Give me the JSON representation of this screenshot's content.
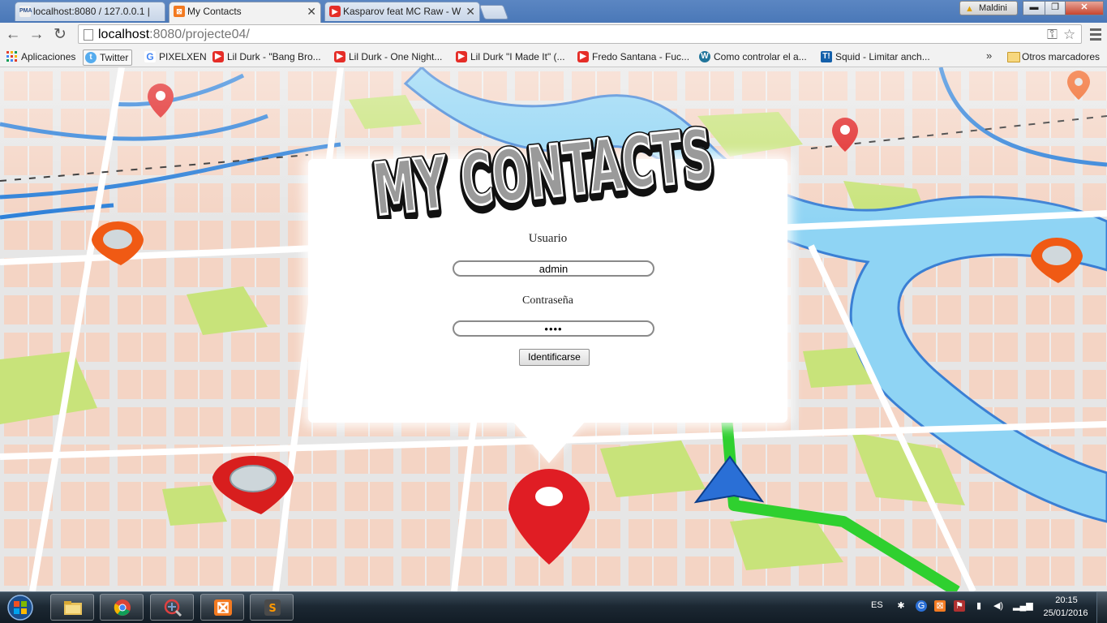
{
  "browser": {
    "tabs": [
      {
        "title": "localhost:8080 / 127.0.0.1 |",
        "icon": "phpmyadmin-icon",
        "state": "inactive"
      },
      {
        "title": "My Contacts",
        "icon": "xampp-icon",
        "state": "active"
      },
      {
        "title": "Kasparov feat MC Raw - W",
        "icon": "youtube-icon",
        "state": "inactive"
      }
    ],
    "profile_name": "Maldini",
    "address": {
      "host": "localhost",
      "path": ":8080/projecte04/"
    },
    "bookmarks": [
      {
        "label": "Aplicaciones",
        "icon": "apps-grid-icon"
      },
      {
        "label": "Twitter",
        "icon": "twitter-icon"
      },
      {
        "label": "PIXELXEN",
        "icon": "google-icon"
      },
      {
        "label": "Lil Durk - \"Bang Bro...",
        "icon": "youtube-icon"
      },
      {
        "label": "Lil Durk - One Night...",
        "icon": "youtube-icon"
      },
      {
        "label": "Lil Durk \"I Made It\" (...",
        "icon": "youtube-icon"
      },
      {
        "label": "Fredo Santana - Fuc...",
        "icon": "youtube-icon"
      },
      {
        "label": "Como controlar el a...",
        "icon": "wordpress-icon"
      },
      {
        "label": "Squid - Limitar anch...",
        "icon": "t-icon"
      }
    ],
    "overflow": "»",
    "other_bookmarks": "Otros marcadores"
  },
  "page": {
    "logo_text": "MY CONTACTS",
    "username_label": "Usuario",
    "username_value": "admin",
    "password_label": "Contraseña",
    "password_value": "••••",
    "submit_label": "Identificarse"
  },
  "taskbar": {
    "language": "ES",
    "time": "20:15",
    "date": "25/01/2016",
    "apps": [
      "file-explorer-icon",
      "chrome-icon",
      "network-tool-icon",
      "xampp-icon",
      "sublime-text-icon"
    ]
  },
  "colors": {
    "tabstrip": "#4a78b8",
    "pin_red": "#e02020",
    "route_green": "#22cc22",
    "nav_arrow_blue": "#2a6fd6"
  }
}
